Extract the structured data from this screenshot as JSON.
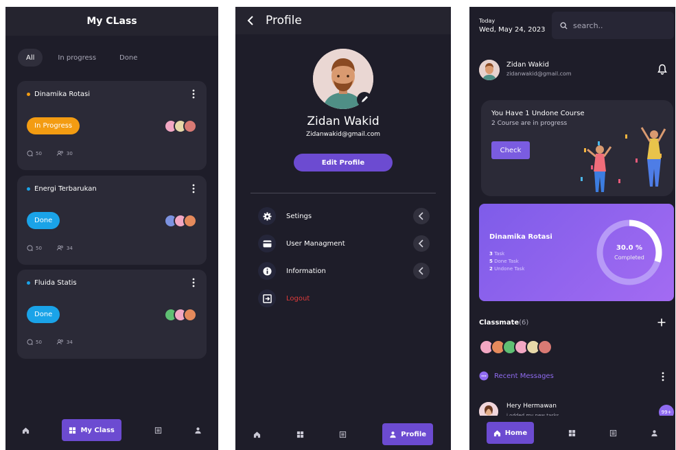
{
  "myclass": {
    "title": "My CLass",
    "filters": [
      "All",
      "In progress",
      "Done"
    ],
    "courses": [
      {
        "name": "Dinamika Rotasi",
        "dot_color": "#f39c12",
        "status": "In Progress",
        "status_color": "#f39c12",
        "comments": "50",
        "members": "30"
      },
      {
        "name": "Energi Terbarukan",
        "dot_color": "#1aa3e8",
        "status": "Done",
        "status_color": "#1aa3e8",
        "comments": "50",
        "members": "34"
      },
      {
        "name": "Fluida Statis",
        "dot_color": "#1aa3e8",
        "status": "Done",
        "status_color": "#1aa3e8",
        "comments": "50",
        "members": "34"
      }
    ],
    "nav_active_label": "My Class"
  },
  "profile": {
    "title": "Profile",
    "name": "Zidan Wakid",
    "email": "Zidanwakid@gmail.com",
    "edit_button": "Edit Profile",
    "menu": [
      "Setings",
      "User Managment",
      "Information"
    ],
    "logout": "Logout",
    "nav_active_label": "Profile"
  },
  "home": {
    "today_label": "Today",
    "date": "Wed, May 24, 2023",
    "search_placeholder": "search..",
    "user_name": "Zidan Wakid",
    "user_email": "zidanwakid@gmail.com",
    "undone_title": "You Have 1 Undone Course",
    "undone_sub": "2 Course are in progress",
    "check_button": "Check",
    "course": {
      "title": "Dinamika Rotasi",
      "tasks_num": "3",
      "tasks_lbl": "Task",
      "done_num": "5",
      "done_lbl": "Done Task",
      "undone_num": "2",
      "undone_lbl": "Undone Task",
      "percent": "30.0 %",
      "percent_label": "Completed",
      "progress": 0.3
    },
    "classmate_label": "Classmate",
    "classmate_count": "(6)",
    "recent_label": "Recent Messages",
    "message": {
      "name": "Hery Hermawan",
      "text": "i odded my new tasks",
      "badge": "99+"
    },
    "nav_active_label": "Home"
  },
  "colors": {
    "accent": "#6c4bd1",
    "background": "#1e1d29",
    "card": "#2b2a37",
    "logout": "#e03b3b"
  }
}
